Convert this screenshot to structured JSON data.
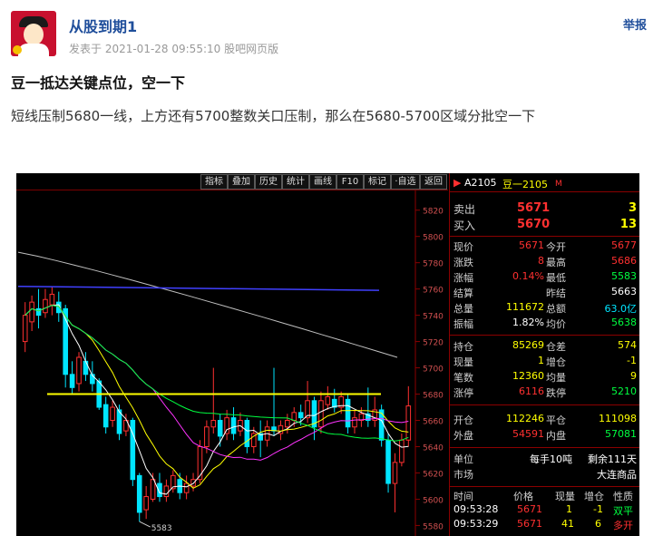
{
  "post": {
    "username": "从股到期1",
    "meta": "发表于 2021-01-28 09:55:10 股吧网页版",
    "report": "举报",
    "title": "豆一抵达关键点位，空一下",
    "content": "短线压制5680一线，上方还有5700整数关口压制，那么在5680-5700区域分批空一下"
  },
  "terminal": {
    "toolbar": [
      "指标",
      "叠加",
      "历史",
      "统计",
      "画线",
      "F10",
      "标记",
      "·自选",
      "返回"
    ],
    "code": "A2105",
    "name": "豆一2105",
    "flag": "M",
    "orderbook": {
      "sell_label": "卖出",
      "sell_price": "5671",
      "sell_vol": "3",
      "buy_label": "买入",
      "buy_price": "5670",
      "buy_vol": "13"
    },
    "quote": [
      {
        "l1": "现价",
        "v1": "5671",
        "l2": "今开",
        "v2": "5677"
      },
      {
        "l1": "涨跌",
        "v1": "8",
        "l2": "最高",
        "v2": "5686"
      },
      {
        "l1": "涨幅",
        "v1": "0.14%",
        "l2": "最低",
        "v2": "5583"
      },
      {
        "l1": "结算",
        "v1": "",
        "l2": "昨结",
        "v2": "5663"
      },
      {
        "l1": "总量",
        "v1": "111672",
        "l2": "总额",
        "v2": "63.0亿"
      },
      {
        "l1": "振幅",
        "v1": "1.82%",
        "l2": "均价",
        "v2": "5638"
      }
    ],
    "position": [
      {
        "l1": "持仓",
        "v1": "85269",
        "l2": "仓差",
        "v2": "574"
      },
      {
        "l1": "现量",
        "v1": "1",
        "l2": "增仓",
        "v2": "-1"
      },
      {
        "l1": "笔数",
        "v1": "12360",
        "l2": "均量",
        "v2": "9"
      },
      {
        "l1": "涨停",
        "v1": "6116",
        "l2": "跌停",
        "v2": "5210"
      }
    ],
    "volume": [
      {
        "l1": "开仓",
        "v1": "112246",
        "l2": "平仓",
        "v2": "111098"
      },
      {
        "l1": "外盘",
        "v1": "54591",
        "l2": "内盘",
        "v2": "57081"
      }
    ],
    "unit": {
      "label": "单位",
      "value": "每手10吨",
      "extra": "剩余111天"
    },
    "market": {
      "label": "市场",
      "value": "大连商品"
    },
    "ticks_header": [
      "时间",
      "价格",
      "现量",
      "增仓",
      "性质"
    ],
    "ticks": [
      {
        "time": "09:53:28",
        "price": "5671",
        "vol": "1",
        "oi": "-1",
        "nature": "双平"
      },
      {
        "time": "09:53:29",
        "price": "5671",
        "vol": "41",
        "oi": "6",
        "nature": "多开"
      }
    ],
    "colors": {
      "up": "#ff3030",
      "down": "#00e5ff",
      "text": "#d0d0d0",
      "grid": "#8b0000",
      "key_level": "#ffff00"
    }
  },
  "chart_data": {
    "type": "candlestick",
    "y_axis_ticks": [
      5820,
      5800,
      5780,
      5760,
      5740,
      5720,
      5700,
      5680,
      5660,
      5640,
      5620,
      5600,
      5580
    ],
    "ylim": [
      5572,
      5835
    ],
    "key_level": 5680,
    "low_marker": "5583",
    "candles": [
      {
        "o": 5720,
        "c": 5740,
        "h": 5750,
        "l": 5712
      },
      {
        "o": 5735,
        "c": 5750,
        "h": 5755,
        "l": 5728
      },
      {
        "o": 5745,
        "c": 5740,
        "h": 5760,
        "l": 5730
      },
      {
        "o": 5742,
        "c": 5752,
        "h": 5760,
        "l": 5738
      },
      {
        "o": 5748,
        "c": 5756,
        "h": 5762,
        "l": 5740
      },
      {
        "o": 5750,
        "c": 5742,
        "h": 5758,
        "l": 5735
      },
      {
        "o": 5745,
        "c": 5695,
        "h": 5748,
        "l": 5685
      },
      {
        "o": 5695,
        "c": 5685,
        "h": 5705,
        "l": 5680
      },
      {
        "o": 5688,
        "c": 5708,
        "h": 5712,
        "l": 5682
      },
      {
        "o": 5705,
        "c": 5695,
        "h": 5712,
        "l": 5690
      },
      {
        "o": 5695,
        "c": 5688,
        "h": 5705,
        "l": 5682
      },
      {
        "o": 5690,
        "c": 5670,
        "h": 5692,
        "l": 5668
      },
      {
        "o": 5672,
        "c": 5655,
        "h": 5678,
        "l": 5650
      },
      {
        "o": 5660,
        "c": 5670,
        "h": 5675,
        "l": 5655
      },
      {
        "o": 5668,
        "c": 5650,
        "h": 5672,
        "l": 5645
      },
      {
        "o": 5652,
        "c": 5660,
        "h": 5665,
        "l": 5648
      },
      {
        "o": 5660,
        "c": 5615,
        "h": 5662,
        "l": 5610
      },
      {
        "o": 5618,
        "c": 5590,
        "h": 5620,
        "l": 5583
      },
      {
        "o": 5592,
        "c": 5602,
        "h": 5610,
        "l": 5585
      },
      {
        "o": 5600,
        "c": 5615,
        "h": 5620,
        "l": 5598
      },
      {
        "o": 5612,
        "c": 5602,
        "h": 5620,
        "l": 5598
      },
      {
        "o": 5602,
        "c": 5610,
        "h": 5615,
        "l": 5598
      },
      {
        "o": 5608,
        "c": 5618,
        "h": 5622,
        "l": 5605
      },
      {
        "o": 5615,
        "c": 5605,
        "h": 5620,
        "l": 5600
      },
      {
        "o": 5605,
        "c": 5612,
        "h": 5618,
        "l": 5600
      },
      {
        "o": 5610,
        "c": 5615,
        "h": 5620,
        "l": 5606
      },
      {
        "o": 5615,
        "c": 5640,
        "h": 5645,
        "l": 5612
      },
      {
        "o": 5640,
        "c": 5655,
        "h": 5660,
        "l": 5635
      },
      {
        "o": 5655,
        "c": 5660,
        "h": 5700,
        "l": 5650
      },
      {
        "o": 5660,
        "c": 5648,
        "h": 5665,
        "l": 5640
      },
      {
        "o": 5650,
        "c": 5662,
        "h": 5668,
        "l": 5645
      },
      {
        "o": 5662,
        "c": 5650,
        "h": 5670,
        "l": 5645
      },
      {
        "o": 5652,
        "c": 5660,
        "h": 5666,
        "l": 5648
      },
      {
        "o": 5660,
        "c": 5640,
        "h": 5662,
        "l": 5635
      },
      {
        "o": 5640,
        "c": 5650,
        "h": 5655,
        "l": 5635
      },
      {
        "o": 5650,
        "c": 5645,
        "h": 5660,
        "l": 5632
      },
      {
        "o": 5645,
        "c": 5655,
        "h": 5660,
        "l": 5640
      },
      {
        "o": 5655,
        "c": 5652,
        "h": 5700,
        "l": 5648
      },
      {
        "o": 5650,
        "c": 5656,
        "h": 5660,
        "l": 5645
      },
      {
        "o": 5655,
        "c": 5660,
        "h": 5665,
        "l": 5650
      },
      {
        "o": 5660,
        "c": 5666,
        "h": 5670,
        "l": 5655
      },
      {
        "o": 5666,
        "c": 5662,
        "h": 5672,
        "l": 5656
      },
      {
        "o": 5662,
        "c": 5675,
        "h": 5690,
        "l": 5658
      },
      {
        "o": 5675,
        "c": 5655,
        "h": 5678,
        "l": 5645
      },
      {
        "o": 5655,
        "c": 5675,
        "h": 5682,
        "l": 5650
      },
      {
        "o": 5672,
        "c": 5678,
        "h": 5686,
        "l": 5668
      },
      {
        "o": 5676,
        "c": 5670,
        "h": 5684,
        "l": 5666
      },
      {
        "o": 5670,
        "c": 5678,
        "h": 5682,
        "l": 5665
      },
      {
        "o": 5676,
        "c": 5655,
        "h": 5680,
        "l": 5650
      },
      {
        "o": 5655,
        "c": 5662,
        "h": 5668,
        "l": 5650
      },
      {
        "o": 5660,
        "c": 5665,
        "h": 5670,
        "l": 5655
      },
      {
        "o": 5665,
        "c": 5660,
        "h": 5685,
        "l": 5655
      },
      {
        "o": 5660,
        "c": 5668,
        "h": 5678,
        "l": 5655
      },
      {
        "o": 5668,
        "c": 5645,
        "h": 5672,
        "l": 5640
      },
      {
        "o": 5645,
        "c": 5612,
        "h": 5650,
        "l": 5605
      },
      {
        "o": 5612,
        "c": 5628,
        "h": 5635,
        "l": 5590
      },
      {
        "o": 5628,
        "c": 5645,
        "h": 5650,
        "l": 5625
      },
      {
        "o": 5645,
        "c": 5671,
        "h": 5686,
        "l": 5640
      }
    ]
  }
}
